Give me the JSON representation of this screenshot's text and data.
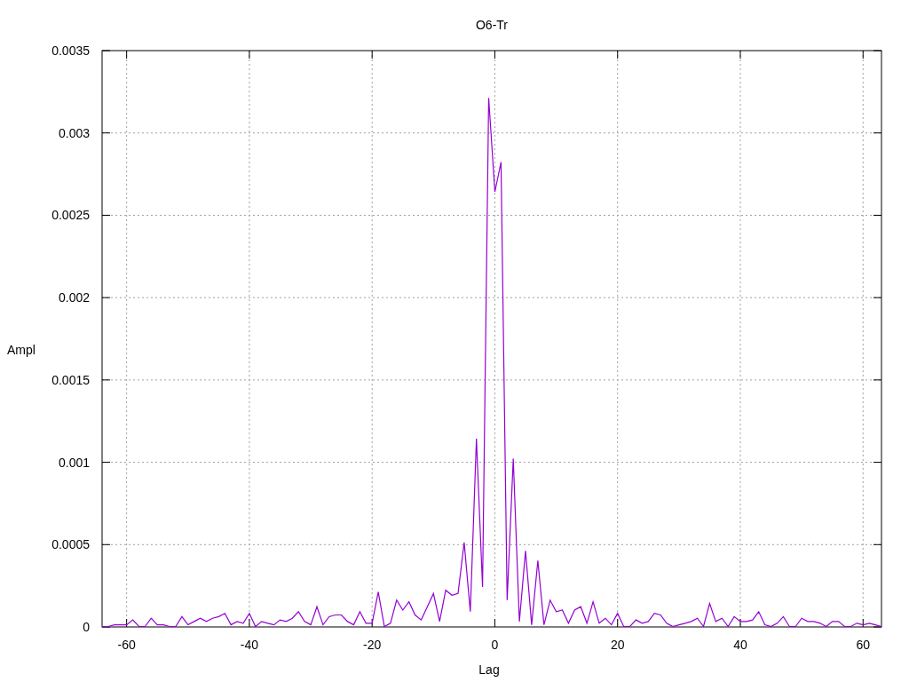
{
  "chart": {
    "chart_data": {
      "type": "line",
      "title": "O6-Tr",
      "xlabel": "Lag",
      "ylabel": "Ampl",
      "x": [
        -64,
        -63,
        -62,
        -61,
        -60,
        -59,
        -58,
        -57,
        -56,
        -55,
        -54,
        -53,
        -52,
        -51,
        -50,
        -49,
        -48,
        -47,
        -46,
        -45,
        -44,
        -43,
        -42,
        -41,
        -40,
        -39,
        -38,
        -37,
        -36,
        -35,
        -34,
        -33,
        -32,
        -31,
        -30,
        -29,
        -28,
        -27,
        -26,
        -25,
        -24,
        -23,
        -22,
        -21,
        -20,
        -19,
        -18,
        -17,
        -16,
        -15,
        -14,
        -13,
        -12,
        -11,
        -10,
        -9,
        -8,
        -7,
        -6,
        -5,
        -4,
        -3,
        -2,
        -1,
        0,
        1,
        2,
        3,
        4,
        5,
        6,
        7,
        8,
        9,
        10,
        11,
        12,
        13,
        14,
        15,
        16,
        17,
        18,
        19,
        20,
        21,
        22,
        23,
        24,
        25,
        26,
        27,
        28,
        29,
        30,
        31,
        32,
        33,
        34,
        35,
        36,
        37,
        38,
        39,
        40,
        41,
        42,
        43,
        44,
        45,
        46,
        47,
        48,
        49,
        50,
        51,
        52,
        53,
        54,
        55,
        56,
        57,
        58,
        59,
        60,
        61,
        62,
        63
      ],
      "series": [
        {
          "color": "#9400d3",
          "values": [
            0,
            0,
            1e-05,
            1e-05,
            1e-05,
            4e-05,
            0,
            0,
            5e-05,
            1e-05,
            1e-05,
            0,
            0,
            6e-05,
            1e-05,
            3e-05,
            5e-05,
            3e-05,
            5e-05,
            6e-05,
            8e-05,
            1e-05,
            3e-05,
            2e-05,
            8e-05,
            0,
            3e-05,
            2e-05,
            1e-05,
            4e-05,
            3e-05,
            5e-05,
            9e-05,
            3e-05,
            1e-05,
            0.00012,
            1e-05,
            6e-05,
            7e-05,
            7e-05,
            3e-05,
            1e-05,
            9e-05,
            2e-05,
            2e-05,
            0.00021,
            0,
            2e-05,
            0.00016,
            0.0001,
            0.00015,
            7e-05,
            4e-05,
            0.00012,
            0.0002,
            3e-05,
            0.00022,
            0.00019,
            0.0002,
            0.00051,
            9e-05,
            0.00114,
            0.00024,
            0.00321,
            0.00264,
            0.00282,
            0.00016,
            0.00102,
            3e-05,
            0.00046,
            1e-05,
            0.0004,
            1e-05,
            0.00016,
            9e-05,
            0.0001,
            2e-05,
            0.0001,
            0.00012,
            2e-05,
            0.00015,
            2e-05,
            5e-05,
            1e-05,
            8e-05,
            0,
            0,
            4e-05,
            2e-05,
            3e-05,
            8e-05,
            7e-05,
            2e-05,
            0,
            1e-05,
            2e-05,
            3e-05,
            5e-05,
            0,
            0.00014,
            3e-05,
            5e-05,
            0,
            6e-05,
            3e-05,
            3e-05,
            4e-05,
            9e-05,
            1e-05,
            0,
            2e-05,
            6e-05,
            0,
            0,
            5e-05,
            3e-05,
            3e-05,
            2e-05,
            0,
            3e-05,
            3e-05,
            0,
            0,
            2e-05,
            1e-05,
            2e-05,
            1e-05,
            0
          ]
        }
      ],
      "grid": true,
      "xlim": [
        -64,
        63
      ],
      "ylim": [
        0,
        0.0035
      ],
      "xticks": [
        {
          "value": -60,
          "label": "-60"
        },
        {
          "value": -40,
          "label": "-40"
        },
        {
          "value": -20,
          "label": "-20"
        },
        {
          "value": 0,
          "label": "0"
        },
        {
          "value": 20,
          "label": "20"
        },
        {
          "value": 40,
          "label": "40"
        },
        {
          "value": 60,
          "label": "60"
        }
      ],
      "yticks": [
        {
          "value": 0,
          "label": "0"
        },
        {
          "value": 0.0005,
          "label": "0.0005"
        },
        {
          "value": 0.001,
          "label": "0.001"
        },
        {
          "value": 0.0015,
          "label": "0.0015"
        },
        {
          "value": 0.002,
          "label": "0.002"
        },
        {
          "value": 0.0025,
          "label": "0.0025"
        },
        {
          "value": 0.003,
          "label": "0.003"
        },
        {
          "value": 0.0035,
          "label": "0.0035"
        }
      ]
    }
  }
}
